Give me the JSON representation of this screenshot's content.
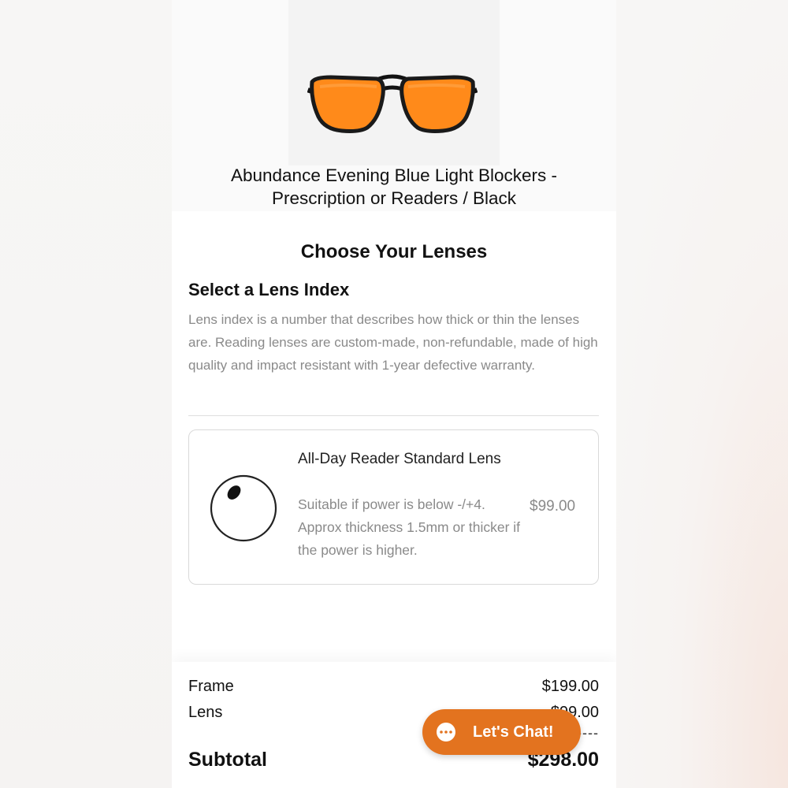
{
  "product": {
    "title": "Abundance Evening Blue Light Blockers - Prescription or Readers / Black",
    "image_icon": "orange-aviator-glasses"
  },
  "lenses": {
    "section_title": "Choose Your Lenses",
    "index_title": "Select a Lens Index",
    "description": "Lens index is a number that describes how thick or thin the lenses are. Reading lenses are custom-made, non-refundable, made of high quality and impact resistant with 1-year defective warranty.",
    "options": [
      {
        "name": "All-Day Reader Standard Lens",
        "description": "Suitable if power is below -/+4. Approx thickness 1.5mm or thicker if the power is higher.",
        "price": "$99.00",
        "icon": "lens-circle-icon"
      }
    ]
  },
  "summary": {
    "frame_label": "Frame",
    "frame_price": "$199.00",
    "lens_label": "Lens",
    "lens_price": "$99.00",
    "separator": "-------",
    "subtotal_label": "Subtotal",
    "subtotal_price": "$298.00"
  },
  "chat": {
    "label": "Let's Chat!",
    "color": "#e3731f"
  }
}
